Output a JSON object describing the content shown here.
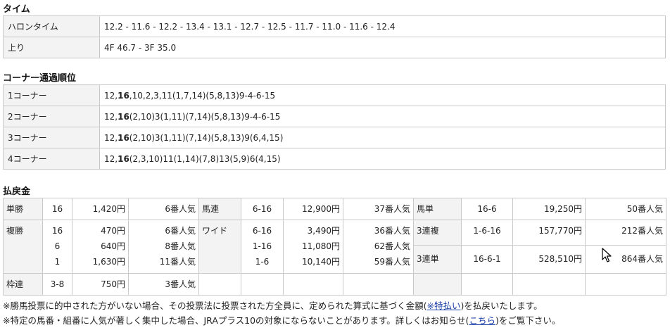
{
  "sections": {
    "time_title": "タイム",
    "corner_title": "コーナー通過順位",
    "payout_title": "払戻金"
  },
  "time_rows": [
    {
      "label": "ハロンタイム",
      "value": "12.2 - 11.6 - 12.2 - 13.4 - 13.1 - 12.7 - 12.5 - 11.7 - 11.0 - 11.6 - 12.4"
    },
    {
      "label": "上り",
      "value": "4F 46.7 - 3F 35.0"
    }
  ],
  "corner_rows": [
    {
      "label": "1コーナー",
      "pre": "12,",
      "bold": "16",
      "post": ",10,2,3,11(1,7,14)(5,8,13)9-4-6-15"
    },
    {
      "label": "2コーナー",
      "pre": "12,",
      "bold": "16",
      "post": "(2,10)3(1,11)(7,14)(5,8,13)9-4-6-15"
    },
    {
      "label": "3コーナー",
      "pre": "12,",
      "bold": "16",
      "post": "(2,10)3(1,11)(7,14)(5,8,13)9(6,4,15)"
    },
    {
      "label": "4コーナー",
      "pre": "12,",
      "bold": "16",
      "post": "(2,3,10)11(1,14)(7,8)13(5,9)6(4,15)"
    }
  ],
  "payout": {
    "tansho": {
      "type": "単勝",
      "rows": [
        {
          "num": "16",
          "pay": "1,420円",
          "pop": "6番人気"
        }
      ]
    },
    "fukusho": {
      "type": "複勝",
      "rows": [
        {
          "num": "16",
          "pay": "470円",
          "pop": "6番人気"
        },
        {
          "num": "6",
          "pay": "640円",
          "pop": "8番人気"
        },
        {
          "num": "1",
          "pay": "1,630円",
          "pop": "11番人気"
        }
      ]
    },
    "wakuren": {
      "type": "枠連",
      "rows": [
        {
          "num": "3-8",
          "pay": "750円",
          "pop": "3番人気"
        }
      ]
    },
    "umaren": {
      "type": "馬連",
      "rows": [
        {
          "num": "6-16",
          "pay": "12,900円",
          "pop": "37番人気"
        }
      ]
    },
    "wide": {
      "type": "ワイド",
      "rows": [
        {
          "num": "6-16",
          "pay": "3,490円",
          "pop": "36番人気"
        },
        {
          "num": "1-16",
          "pay": "11,080円",
          "pop": "62番人気"
        },
        {
          "num": "1-6",
          "pay": "10,140円",
          "pop": "59番人気"
        }
      ]
    },
    "umatan": {
      "type": "馬単",
      "rows": [
        {
          "num": "16-6",
          "pay": "19,250円",
          "pop": "50番人気"
        }
      ]
    },
    "sanrenpuku": {
      "type": "3連複",
      "rows": [
        {
          "num": "1-6-16",
          "pay": "157,770円",
          "pop": "212番人気"
        }
      ]
    },
    "sanrentan": {
      "type": "3連単",
      "rows": [
        {
          "num": "16-6-1",
          "pay": "528,510円",
          "pop": "864番人気"
        }
      ]
    }
  },
  "notes": {
    "line1_pre": "※勝馬投票に的中された方がいない場合、その投票法に投票された方全員に、定められた算式に基づく金額(",
    "line1_link": "※特払い",
    "line1_post": ")を払戻いたします。",
    "line2_pre": "※特定の馬番・組番に人気が著しく集中した場合、JRAプラス10の対象にならないことがあります。詳しくはお知らせ(",
    "line2_link": "こちら",
    "line2_post": ")をご覧下さい。"
  },
  "cursor_icon": "mouse-pointer-icon"
}
